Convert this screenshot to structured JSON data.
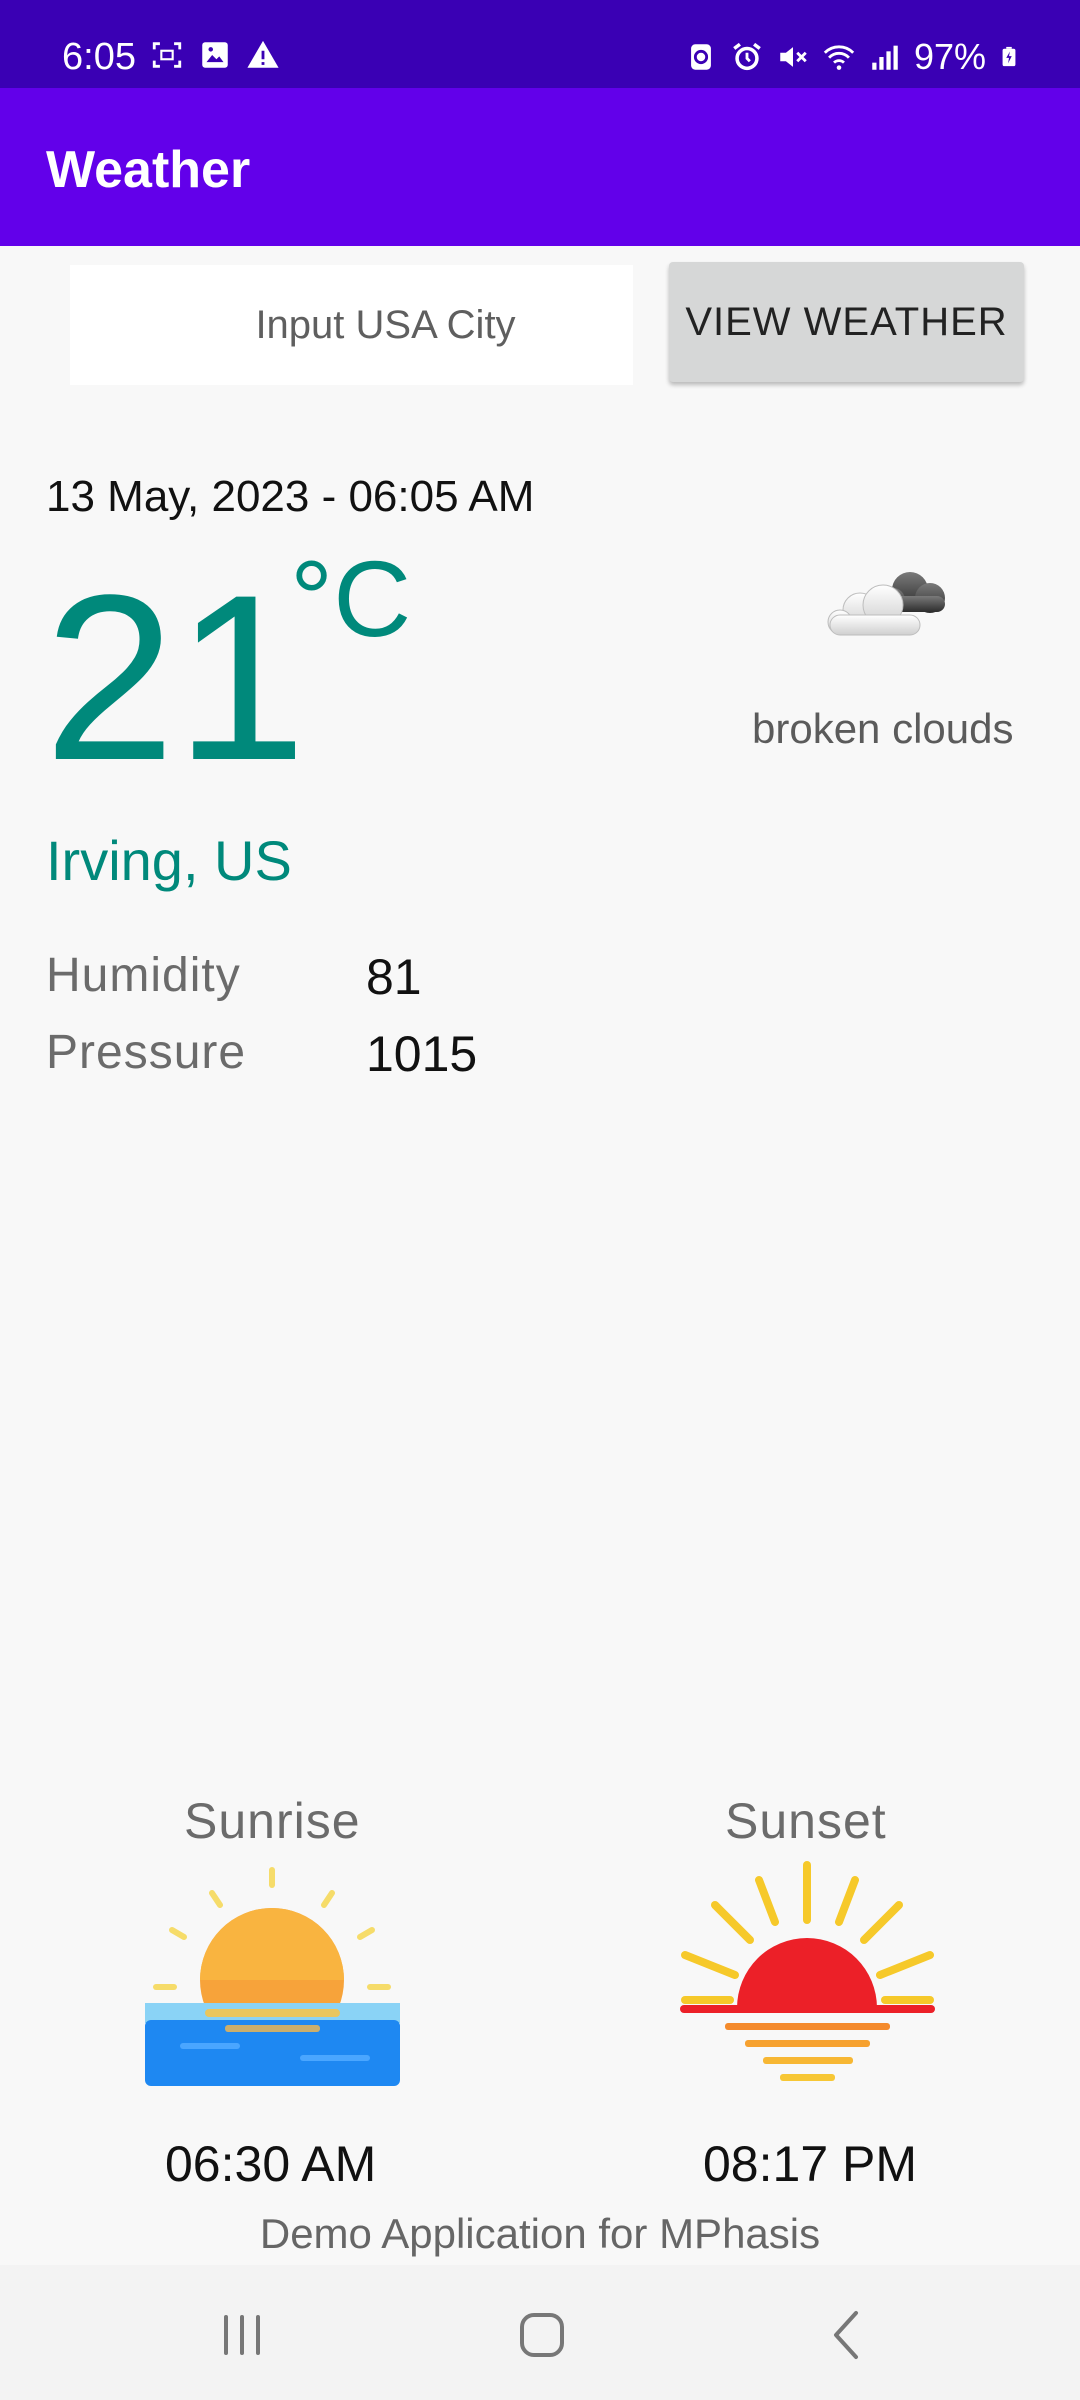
{
  "status_bar": {
    "time": "6:05",
    "battery": "97%",
    "icons_left": [
      "screenshot-icon",
      "image-icon",
      "warning-icon"
    ],
    "icons_right": [
      "data-saver-icon",
      "alarm-icon",
      "mute-icon",
      "wifi-icon",
      "signal-icon",
      "battery-icon"
    ]
  },
  "app_bar": {
    "title": "Weather"
  },
  "search": {
    "placeholder": "Input USA City",
    "value": ""
  },
  "button": {
    "label": "VIEW WEATHER"
  },
  "weather": {
    "datetime": "13 May, 2023 - 06:05 AM",
    "temperature": "21",
    "unit": "°C",
    "location": "Irving, US",
    "condition": "broken clouds",
    "condition_icon": "broken-clouds-icon"
  },
  "details": {
    "humidity_label": "Humidity",
    "humidity_value": "81",
    "pressure_label": "Pressure",
    "pressure_value": "1015"
  },
  "sun": {
    "sunrise_label": "Sunrise",
    "sunrise_time": "06:30 AM",
    "sunset_label": "Sunset",
    "sunset_time": "08:17 PM"
  },
  "footer": {
    "text": "Demo Application for MPhasis"
  },
  "colors": {
    "status_bar": "#3a00b4",
    "app_bar": "#6200ea",
    "accent": "#00897b"
  }
}
